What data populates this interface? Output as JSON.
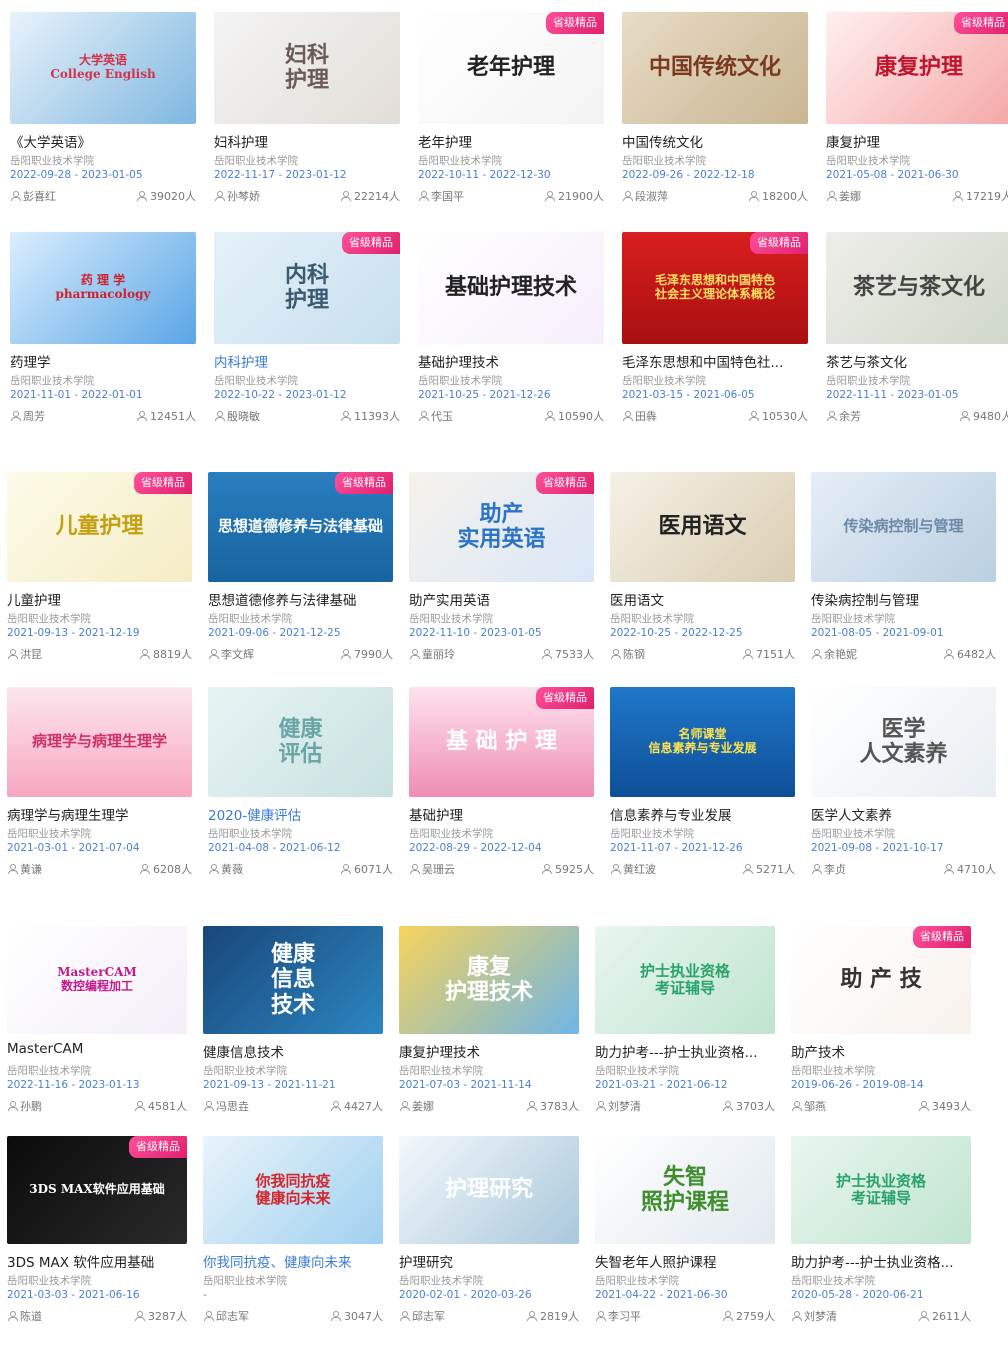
{
  "common": {
    "school": "岳阳职业技术学院",
    "badge": "省级精品"
  },
  "groups": [
    {
      "name": "group-1",
      "rows": [
        [
          {
            "title": "《大学英语》",
            "dates": "2022-09-28 - 2023-01-05",
            "teacher": "彭喜红",
            "count": "39020人",
            "thumb": "大学英语\nCollege English",
            "bg": "linear-gradient(135deg,#e9f3fb,#7fb7e0)",
            "fg": "#d2334a",
            "badge": false,
            "blue": false
          },
          {
            "title": "妇科护理",
            "dates": "2022-11-17 - 2023-01-12",
            "teacher": "孙棽娇",
            "count": "22214人",
            "thumb": "妇科\n护理",
            "bg": "linear-gradient(135deg,#f4f4f4,#e2ddd8)",
            "fg": "#6a5a5a",
            "badge": false,
            "blue": false
          },
          {
            "title": "老年护理",
            "dates": "2022-10-11 - 2022-12-30",
            "teacher": "李国平",
            "count": "21900人",
            "thumb": "老年护理",
            "bg": "linear-gradient(135deg,#ffffff,#f3f3f3)",
            "fg": "#222",
            "badge": true,
            "blue": false
          },
          {
            "title": "中国传统文化",
            "dates": "2022-09-26 - 2022-12-18",
            "teacher": "段淑萍",
            "count": "18200人",
            "thumb": "中国传统文化",
            "bg": "linear-gradient(135deg,#e8dcc6,#c8b592)",
            "fg": "#7b3a20",
            "badge": false,
            "blue": false
          },
          {
            "title": "康复护理",
            "dates": "2021-05-08 - 2021-06-30",
            "teacher": "姜娜",
            "count": "17219人",
            "thumb": "康复护理",
            "bg": "linear-gradient(135deg,#fff0f0,#f5a7a7)",
            "fg": "#c0142c",
            "badge": true,
            "blue": false
          }
        ],
        [
          {
            "title": "药理学",
            "dates": "2021-11-01 - 2022-01-01",
            "teacher": "周芳",
            "count": "12451人",
            "thumb": "药 理 学\npharmacology",
            "bg": "linear-gradient(135deg,#dbeefe,#5aa6e6)",
            "fg": "#d0222e",
            "badge": false,
            "blue": false
          },
          {
            "title": "内科护理",
            "dates": "2022-10-22 - 2023-01-12",
            "teacher": "殷晓敏",
            "count": "11393人",
            "thumb": "内科\n护理",
            "bg": "linear-gradient(135deg,#e4f1f8,#c7dfee)",
            "fg": "#3a5a70",
            "badge": true,
            "blue": true
          },
          {
            "title": "基础护理技术",
            "dates": "2021-10-25 - 2021-12-26",
            "teacher": "代玉",
            "count": "10590人",
            "thumb": "基础护理技术",
            "bg": "linear-gradient(135deg,#ffffff,#f6eefb)",
            "fg": "#222",
            "badge": false,
            "blue": false
          },
          {
            "title": "毛泽东思想和中国特色社...",
            "dates": "2021-03-15 - 2021-06-05",
            "teacher": "田犇",
            "count": "10530人",
            "thumb": "毛泽东思想和中国特色\n社会主义理论体系概论",
            "bg": "linear-gradient(180deg,#d91e1e,#a90f0f)",
            "fg": "#ffe063",
            "badge": true,
            "blue": false
          },
          {
            "title": "茶艺与茶文化",
            "dates": "2022-11-11 - 2023-01-05",
            "teacher": "余芳",
            "count": "9480人",
            "thumb": "茶艺与茶文化",
            "bg": "linear-gradient(135deg,#eeeeea,#cfd7c8)",
            "fg": "#444",
            "badge": false,
            "blue": false
          }
        ]
      ]
    },
    {
      "name": "group-2",
      "rows": [
        [
          {
            "title": "儿童护理",
            "dates": "2021-09-13 - 2021-12-19",
            "teacher": "洪昆",
            "count": "8819人",
            "thumb": "儿童护理",
            "bg": "linear-gradient(135deg,#fdfbe8,#f4ecc5)",
            "fg": "#c3a011",
            "badge": true,
            "blue": false
          },
          {
            "title": "思想道德修养与法律基础",
            "dates": "2021-09-06 - 2021-12-25",
            "teacher": "李文辉",
            "count": "7990人",
            "thumb": "思想道德修养与法律基础",
            "bg": "linear-gradient(180deg,#2a7fc1,#17639f)",
            "fg": "#ffffff",
            "badge": true,
            "blue": false
          },
          {
            "title": "助产实用英语",
            "dates": "2022-11-10 - 2023-01-05",
            "teacher": "童丽玲",
            "count": "7533人",
            "thumb": "助产\n实用英语",
            "bg": "linear-gradient(135deg,#f6f2ec,#d9e7f6)",
            "fg": "#2a73c6",
            "badge": true,
            "blue": false
          },
          {
            "title": "医用语文",
            "dates": "2022-10-25 - 2022-12-25",
            "teacher": "陈钢",
            "count": "7151人",
            "thumb": "医用语文",
            "bg": "linear-gradient(135deg,#f6f1e6,#d9cdb2)",
            "fg": "#222",
            "badge": false,
            "blue": false
          },
          {
            "title": "传染病控制与管理",
            "dates": "2021-08-05 - 2021-09-01",
            "teacher": "余艳妮",
            "count": "6482人",
            "thumb": "传染病控制与管理",
            "bg": "linear-gradient(135deg,#e5eef6,#b9cfe1)",
            "fg": "#6c8aa8",
            "badge": false,
            "blue": false
          }
        ],
        [
          {
            "title": "病理学与病理生理学",
            "dates": "2021-03-01 - 2021-07-04",
            "teacher": "黄谦",
            "count": "6208人",
            "thumb": "病理学与病理生理学",
            "bg": "linear-gradient(180deg,#fde6ee,#f7a7c0)",
            "fg": "#d0306a",
            "badge": false,
            "blue": false
          },
          {
            "title": "2020-健康评估",
            "dates": "2021-04-08 - 2021-06-12",
            "teacher": "黄薇",
            "count": "6071人",
            "thumb": "健康\n评估",
            "bg": "linear-gradient(135deg,#e8f4f4,#c7e1e0)",
            "fg": "#6aa7a4",
            "badge": false,
            "blue": true
          },
          {
            "title": "基础护理",
            "dates": "2022-08-29 - 2022-12-04",
            "teacher": "吴珊云",
            "count": "5925人",
            "thumb": "基 础 护 理",
            "bg": "linear-gradient(180deg,#fde3ee,#f08cb5)",
            "fg": "#ffffff",
            "badge": true,
            "blue": false
          },
          {
            "title": "信息素养与专业发展",
            "dates": "2021-11-07 - 2021-12-26",
            "teacher": "黄红波",
            "count": "5271人",
            "thumb": "名师课堂\n信息素养与专业发展",
            "bg": "linear-gradient(180deg,#1e77c8,#0e4e98)",
            "fg": "#ffe34d",
            "badge": false,
            "blue": false
          },
          {
            "title": "医学人文素养",
            "dates": "2021-09-08 - 2021-10-17",
            "teacher": "李贞",
            "count": "4710人",
            "thumb": "医学\n人文素养",
            "bg": "linear-gradient(135deg,#ffffff,#e9eef2)",
            "fg": "#555",
            "badge": false,
            "blue": false
          }
        ]
      ]
    },
    {
      "name": "group-3",
      "rows": [
        [
          {
            "title": "MasterCAM",
            "dates": "2022-11-16 - 2023-01-13",
            "teacher": "孙鹏",
            "count": "4581人",
            "thumb": "MasterCAM\n数控编程加工",
            "bg": "linear-gradient(135deg,#ffffff,#f3eef8)",
            "fg": "#c21a8b",
            "badge": false,
            "blue": false
          },
          {
            "title": "健康信息技术",
            "dates": "2021-09-13 - 2021-11-21",
            "teacher": "冯思垚",
            "count": "4427人",
            "thumb": "健康\n信息\n技术",
            "bg": "linear-gradient(135deg,#18467a,#2c86c0)",
            "fg": "#ffffff",
            "badge": false,
            "blue": false
          },
          {
            "title": "康复护理技术",
            "dates": "2021-07-03 - 2021-11-14",
            "teacher": "姜娜",
            "count": "3783人",
            "thumb": "康复\n护理技术",
            "bg": "linear-gradient(135deg,#f7d35b,#6fb5e6)",
            "fg": "#ffffff",
            "badge": false,
            "blue": false
          },
          {
            "title": "助力护考---护士执业资格...",
            "dates": "2021-03-21 - 2021-06-12",
            "teacher": "刘梦清",
            "count": "3703人",
            "thumb": "护士执业资格\n考证辅导",
            "bg": "linear-gradient(135deg,#e9f6ef,#bfe4cf)",
            "fg": "#2aa36a",
            "badge": false,
            "blue": false
          },
          {
            "title": "助产技术",
            "dates": "2019-06-26 - 2019-08-14",
            "teacher": "邹燕",
            "count": "3493人",
            "thumb": "助 产 技",
            "bg": "linear-gradient(135deg,#ffffff,#f7f1ec)",
            "fg": "#333",
            "badge": true,
            "blue": false
          }
        ],
        [
          {
            "title": "3DS MAX 软件应用基础",
            "dates": "2021-03-03 - 2021-06-16",
            "teacher": "陈道",
            "count": "3287人",
            "thumb": "3DS MAX软件应用基础",
            "bg": "linear-gradient(135deg,#0b0b0b,#2a2a2a)",
            "fg": "#ffffff",
            "badge": true,
            "blue": false
          },
          {
            "title": "你我同抗疫、健康向未来",
            "dates": "-",
            "teacher": "邱志军",
            "count": "3047人",
            "thumb": "你我同抗疫\n健康向未来",
            "bg": "linear-gradient(135deg,#e9f4fb,#9fd0ef)",
            "fg": "#d4262c",
            "badge": false,
            "blue": true
          },
          {
            "title": "护理研究",
            "dates": "2020-02-01 - 2020-03-26",
            "teacher": "邱志军",
            "count": "2819人",
            "thumb": "护理研究",
            "bg": "linear-gradient(135deg,#f4f8fb,#a9c8dc)",
            "fg": "#ffffff",
            "badge": false,
            "blue": false
          },
          {
            "title": "失智老年人照护课程",
            "dates": "2021-04-22 - 2021-06-30",
            "teacher": "李习平",
            "count": "2759人",
            "thumb": "失智\n照护课程",
            "bg": "linear-gradient(135deg,#ffffff,#e2e9ef)",
            "fg": "#3f8d2c",
            "badge": false,
            "blue": false
          },
          {
            "title": "助力护考---护士执业资格...",
            "dates": "2020-05-28 - 2020-06-21",
            "teacher": "刘梦清",
            "count": "2611人",
            "thumb": "护士执业资格\n考证辅导",
            "bg": "linear-gradient(135deg,#e9f6ef,#bfe4cf)",
            "fg": "#2aa36a",
            "badge": false,
            "blue": false
          }
        ]
      ]
    }
  ]
}
